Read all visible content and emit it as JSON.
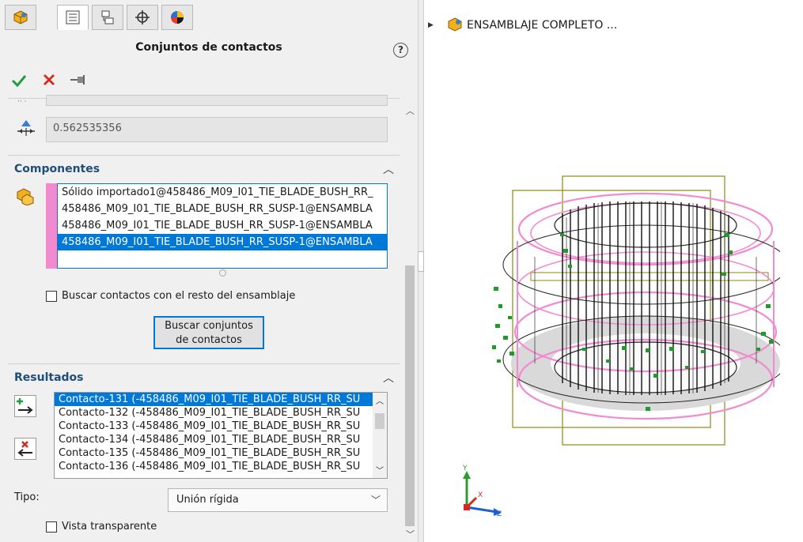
{
  "panel": {
    "title": "Conjuntos de contactos",
    "tabs": [
      "feature-manager-icon",
      "property-manager-icon",
      "configuration-manager-icon",
      "dimxpert-icon",
      "display-manager-icon"
    ],
    "distance_value": "0.562535356",
    "components": {
      "header": "Componentes",
      "items": [
        "Sólido importado1@458486_M09_I01_TIE_BLADE_BUSH_RR_",
        "458486_M09_I01_TIE_BLADE_BUSH_RR_SUSP-1@ENSAMBLA",
        "458486_M09_I01_TIE_BLADE_BUSH_RR_SUSP-1@ENSAMBLA",
        "458486_M09_I01_TIE_BLADE_BUSH_RR_SUSP-1@ENSAMBLA"
      ],
      "selected_index": 3,
      "search_rest_label": "Buscar contactos con el resto del ensamblaje",
      "search_button_line1": "Buscar conjuntos",
      "search_button_line2": "de contactos"
    },
    "results": {
      "header": "Resultados",
      "items": [
        "Contacto-131 (-458486_M09_I01_TIE_BLADE_BUSH_RR_SU",
        "Contacto-132 (-458486_M09_I01_TIE_BLADE_BUSH_RR_SU",
        "Contacto-133 (-458486_M09_I01_TIE_BLADE_BUSH_RR_SU",
        "Contacto-134 (-458486_M09_I01_TIE_BLADE_BUSH_RR_SU",
        "Contacto-135 (-458486_M09_I01_TIE_BLADE_BUSH_RR_SU",
        "Contacto-136 (-458486_M09_I01_TIE_BLADE_BUSH_RR_SU"
      ],
      "selected_index": 0
    },
    "type": {
      "label": "Tipo:",
      "value": "Unión rígida"
    },
    "transparent_label": "Vista transparente"
  },
  "graphics": {
    "tree_root": "ENSAMBLAJE COMPLETO  ...",
    "triad": {
      "x": "X",
      "y": "Y",
      "z": "Z"
    }
  },
  "colors": {
    "accent": "#0078d7",
    "section_header": "#1f4e79",
    "ok_green": "#1e9e3e",
    "cancel_red": "#d42a1f",
    "component_pink": "#f28ad0",
    "contact_green": "#1f9a2c",
    "bbox_olive": "#8a8a10"
  }
}
